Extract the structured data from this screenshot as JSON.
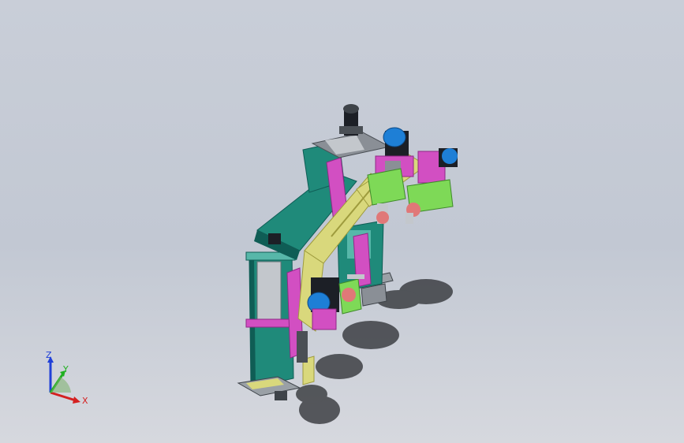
{
  "viewport": {
    "background_top": "#c9ced8",
    "background_bottom": "#d6d8de"
  },
  "model": {
    "description_icon": "cad-assembly-machine",
    "colors": {
      "teal": "#1f8a7a",
      "teal_dark": "#0f5d55",
      "teal_light": "#57b7a9",
      "magenta": "#d24fc2",
      "magenta_dark": "#8f2a86",
      "olive": "#d9d87c",
      "olive_dark": "#9e9b3d",
      "green": "#7ed957",
      "grey": "#8a8f96",
      "grey_dark": "#4a4f55",
      "motor_blue": "#1e7fd6",
      "motor_dark": "#1c1f26",
      "salmon": "#e07878",
      "shadow": "#2a2c30"
    }
  },
  "triad": {
    "x_label": "X",
    "y_label": "Y",
    "z_label": "Z",
    "x_color": "#d42020",
    "y_color": "#20b020",
    "z_color": "#2040d8"
  }
}
